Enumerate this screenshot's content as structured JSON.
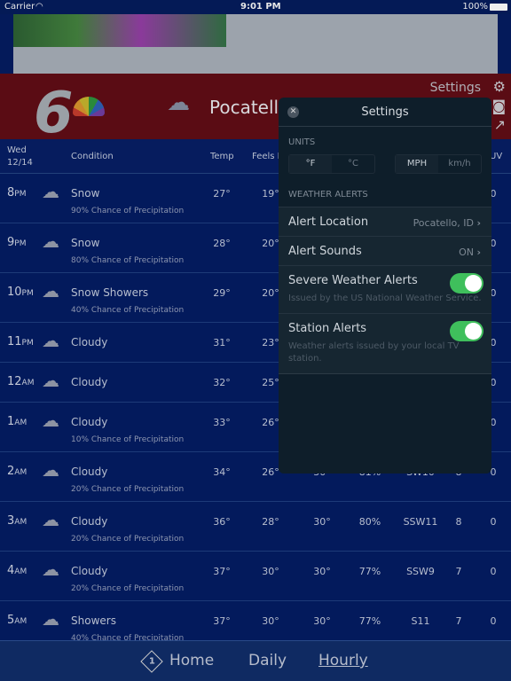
{
  "status": {
    "carrier": "Carrier",
    "time": "9:01 PM",
    "battery": "100%"
  },
  "header": {
    "city": "Pocatello,",
    "settings_label": "Settings",
    "icons": [
      "gear-icon",
      "camera-icon",
      "share-icon"
    ]
  },
  "table": {
    "headers": {
      "date_day": "Wed",
      "date": "12/14",
      "condition": "Condition",
      "temp": "Temp",
      "feels": "Feels Like",
      "uv": "UV"
    },
    "rows": [
      {
        "h": "8",
        "ap": "PM",
        "icon": "snow-icon",
        "cond": "Snow",
        "sub": "90% Chance of Precipitation",
        "temp": "27°",
        "feels": "19°",
        "dew": "",
        "hum": "",
        "wind": "",
        "gust": "",
        "uv": "0"
      },
      {
        "h": "9",
        "ap": "PM",
        "icon": "snow-icon",
        "cond": "Snow",
        "sub": "80% Chance of Precipitation",
        "temp": "28°",
        "feels": "20°",
        "dew": "",
        "hum": "",
        "wind": "",
        "gust": "",
        "uv": "0"
      },
      {
        "h": "10",
        "ap": "PM",
        "icon": "snow-showers-icon",
        "cond": "Snow Showers",
        "sub": "40% Chance of Precipitation",
        "temp": "29°",
        "feels": "20°",
        "dew": "",
        "hum": "",
        "wind": "",
        "gust": "",
        "uv": "0"
      },
      {
        "h": "11",
        "ap": "PM",
        "icon": "cloudy-icon",
        "cond": "Cloudy",
        "sub": "",
        "temp": "31°",
        "feels": "23°",
        "dew": "",
        "hum": "",
        "wind": "",
        "gust": "",
        "uv": "0"
      },
      {
        "h": "12",
        "ap": "AM",
        "icon": "cloudy-icon",
        "cond": "Cloudy",
        "sub": "",
        "temp": "32°",
        "feels": "25°",
        "dew": "",
        "hum": "",
        "wind": "",
        "gust": "",
        "uv": "0"
      },
      {
        "h": "1",
        "ap": "AM",
        "icon": "cloudy-icon",
        "cond": "Cloudy",
        "sub": "10% Chance of Precipitation",
        "temp": "33°",
        "feels": "26°",
        "dew": "",
        "hum": "",
        "wind": "",
        "gust": "",
        "uv": "0"
      },
      {
        "h": "2",
        "ap": "AM",
        "icon": "cloudy-icon",
        "cond": "Cloudy",
        "sub": "20% Chance of Precipitation",
        "temp": "34°",
        "feels": "26°",
        "dew": "30°",
        "hum": "81%",
        "wind": "SW10",
        "gust": "8",
        "uv": "0"
      },
      {
        "h": "3",
        "ap": "AM",
        "icon": "cloudy-icon",
        "cond": "Cloudy",
        "sub": "20% Chance of Precipitation",
        "temp": "36°",
        "feels": "28°",
        "dew": "30°",
        "hum": "80%",
        "wind": "SSW11",
        "gust": "8",
        "uv": "0"
      },
      {
        "h": "4",
        "ap": "AM",
        "icon": "cloudy-icon",
        "cond": "Cloudy",
        "sub": "20% Chance of Precipitation",
        "temp": "37°",
        "feels": "30°",
        "dew": "30°",
        "hum": "77%",
        "wind": "SSW9",
        "gust": "7",
        "uv": "0"
      },
      {
        "h": "5",
        "ap": "AM",
        "icon": "showers-icon",
        "cond": "Showers",
        "sub": "40% Chance of Precipitation",
        "temp": "37°",
        "feels": "30°",
        "dew": "30°",
        "hum": "77%",
        "wind": "S11",
        "gust": "7",
        "uv": "0"
      }
    ]
  },
  "settings": {
    "title": "Settings",
    "units_label": "UNITS",
    "temp_units": [
      "°F",
      "°C"
    ],
    "temp_selected": "°F",
    "wind_units": [
      "MPH",
      "km/h"
    ],
    "wind_selected": "MPH",
    "alerts_label": "WEATHER ALERTS",
    "alert_location": {
      "label": "Alert Location",
      "value": "Pocatello, ID"
    },
    "alert_sounds": {
      "label": "Alert Sounds",
      "value": "ON"
    },
    "severe": {
      "label": "Severe Weather Alerts",
      "desc": "Issued by the US National Weather Service.",
      "on": true
    },
    "station": {
      "label": "Station Alerts",
      "desc": "Weather alerts issued by your local TV station.",
      "on": true
    },
    "toggle_color": "#4cd964"
  },
  "nav": {
    "badge": "1",
    "home": "Home",
    "daily": "Daily",
    "hourly": "Hourly",
    "active": "Hourly"
  }
}
